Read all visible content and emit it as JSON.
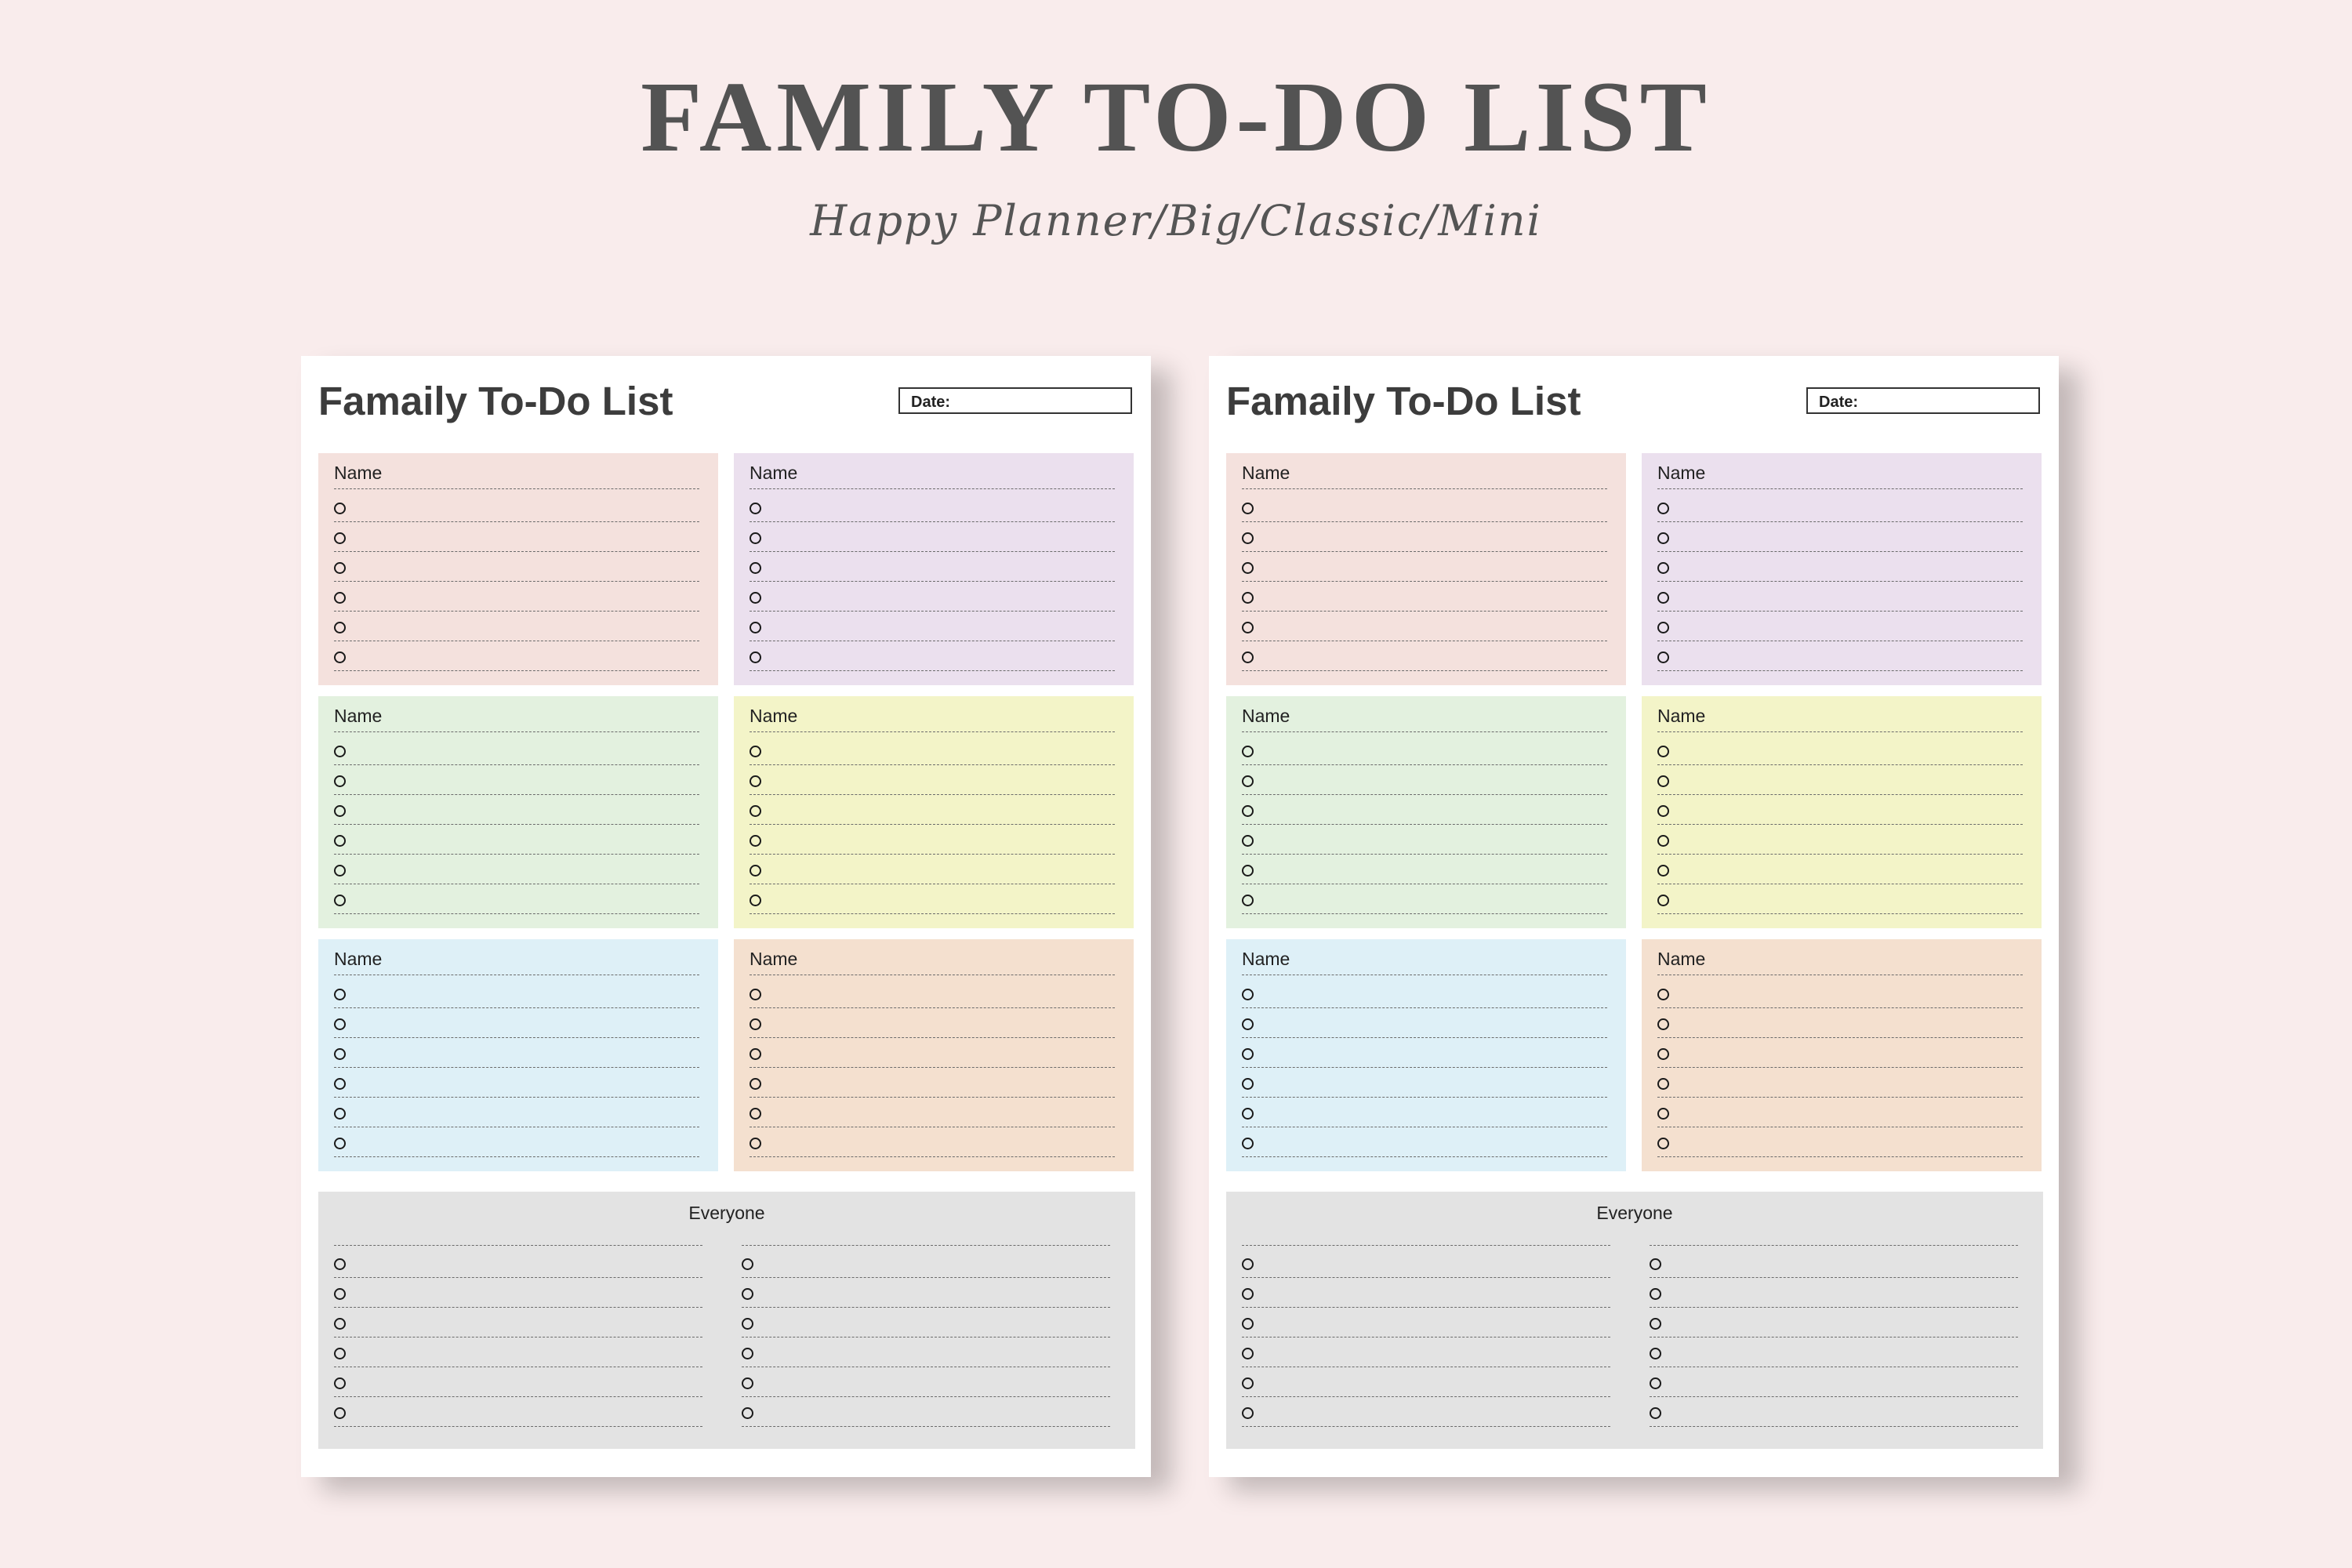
{
  "header": {
    "title": "FAMILY TO-DO LIST",
    "subtitle": "Happy Planner/Big/Classic/Mini"
  },
  "colors": {
    "background": "#f9ecec",
    "card_pink": "#f4e1dd",
    "card_lavender": "#ebe0ee",
    "card_green": "#e3f1df",
    "card_yellow": "#f3f4c8",
    "card_blue": "#def0f7",
    "card_peach": "#f4e0cf",
    "everyone_gray": "#e3e3e3"
  },
  "pages": [
    {
      "title": "Famaily To-Do List",
      "date_label": "Date:",
      "cards": [
        {
          "name": "Name",
          "color": "#f4e1dd",
          "items": 6
        },
        {
          "name": "Name",
          "color": "#ebe0ee",
          "items": 6
        },
        {
          "name": "Name",
          "color": "#e3f1df",
          "items": 6
        },
        {
          "name": "Name",
          "color": "#f3f4c8",
          "items": 6
        },
        {
          "name": "Name",
          "color": "#def0f7",
          "items": 6
        },
        {
          "name": "Name",
          "color": "#f4e0cf",
          "items": 6
        }
      ],
      "everyone": {
        "label": "Everyone",
        "items_per_column": 6,
        "columns": 2
      }
    },
    {
      "title": "Famaily To-Do List",
      "date_label": "Date:",
      "cards": [
        {
          "name": "Name",
          "color": "#f4e1dd",
          "items": 6
        },
        {
          "name": "Name",
          "color": "#ebe0ee",
          "items": 6
        },
        {
          "name": "Name",
          "color": "#e3f1df",
          "items": 6
        },
        {
          "name": "Name",
          "color": "#f3f4c8",
          "items": 6
        },
        {
          "name": "Name",
          "color": "#def0f7",
          "items": 6
        },
        {
          "name": "Name",
          "color": "#f4e0cf",
          "items": 6
        }
      ],
      "everyone": {
        "label": "Everyone",
        "items_per_column": 6,
        "columns": 2
      }
    }
  ]
}
